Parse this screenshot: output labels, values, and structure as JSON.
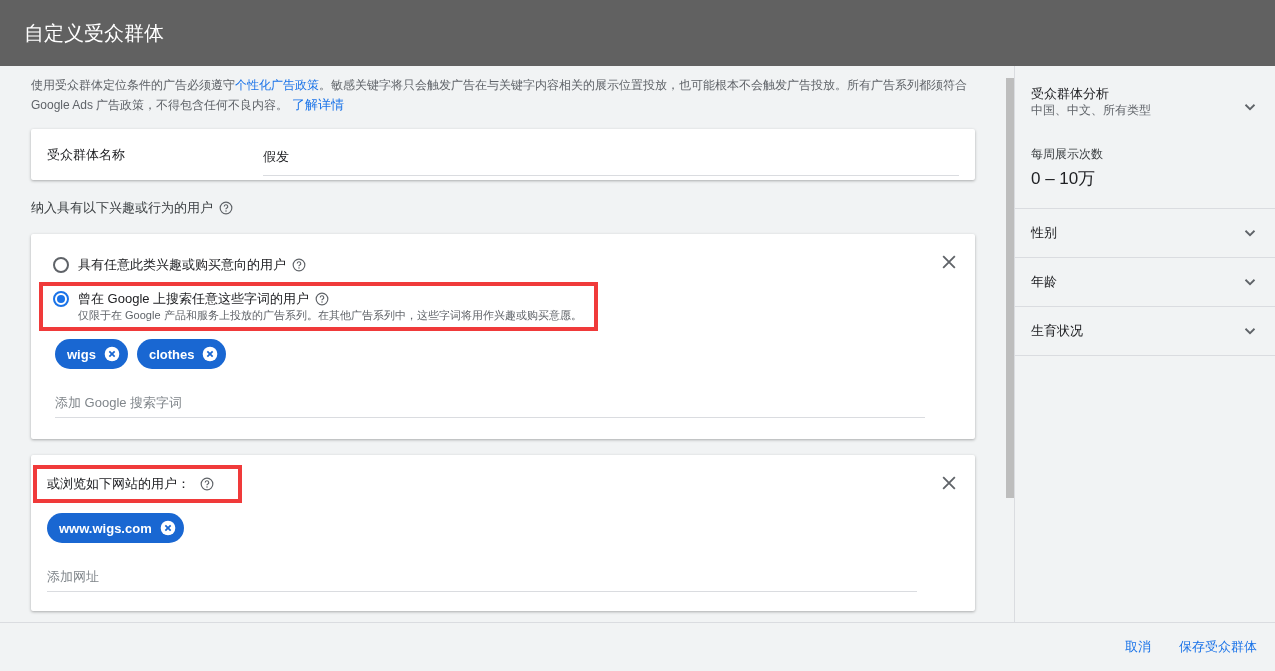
{
  "window": {
    "title": "自定义受众群体"
  },
  "notice": {
    "text": "使用受众群体定位条件的广告必须遵守",
    "link": "个性化广告政策",
    "text_after": "。敏感关键字将只会触发广告在与关键字内容相关的展示位置投放，也可能根本不会触发广告投放。所有广告系列都须符合 Google Ads 广告政策，不得包含任何不良内容。",
    "more_link": "了解详情"
  },
  "name_field": {
    "label": "受众群体名称",
    "value": "假发"
  },
  "include_label": "纳入具有以下兴趣或行为的用户",
  "interest_card": {
    "options": [
      {
        "label": "具有任意此类兴趣或购买意向的用户",
        "selected": false,
        "highlighted": false
      },
      {
        "label": "曾在 Google 上搜索任意这些字词的用户",
        "hint": "仅限于在 Google 产品和服务上投放的广告系列。在其他广告系列中，这些字词将用作兴趣或购买意愿。",
        "selected": true,
        "highlighted": true
      }
    ],
    "chips": [
      "wigs",
      "clothes"
    ],
    "input": {
      "placeholder": "添加 Google 搜索字词"
    }
  },
  "website_card": {
    "title": "或浏览如下网站的用户：",
    "highlighted": true,
    "chips": [
      "www.wigs.com"
    ],
    "input": {
      "placeholder": "添加网址"
    }
  },
  "sidebar": {
    "items": [
      {
        "title": "受众群体分析",
        "subtitle": "中国、中文、所有类型",
        "expanded": false
      },
      {
        "title": "性别",
        "expanded": false
      },
      {
        "title": "年龄",
        "expanded": false
      },
      {
        "title": "生育状况",
        "expanded": false
      }
    ],
    "stat": {
      "label": "每周展示次数",
      "value": "0 – 10万"
    }
  },
  "footer": {
    "buttons": [
      "取消",
      "保存受众群体"
    ]
  }
}
